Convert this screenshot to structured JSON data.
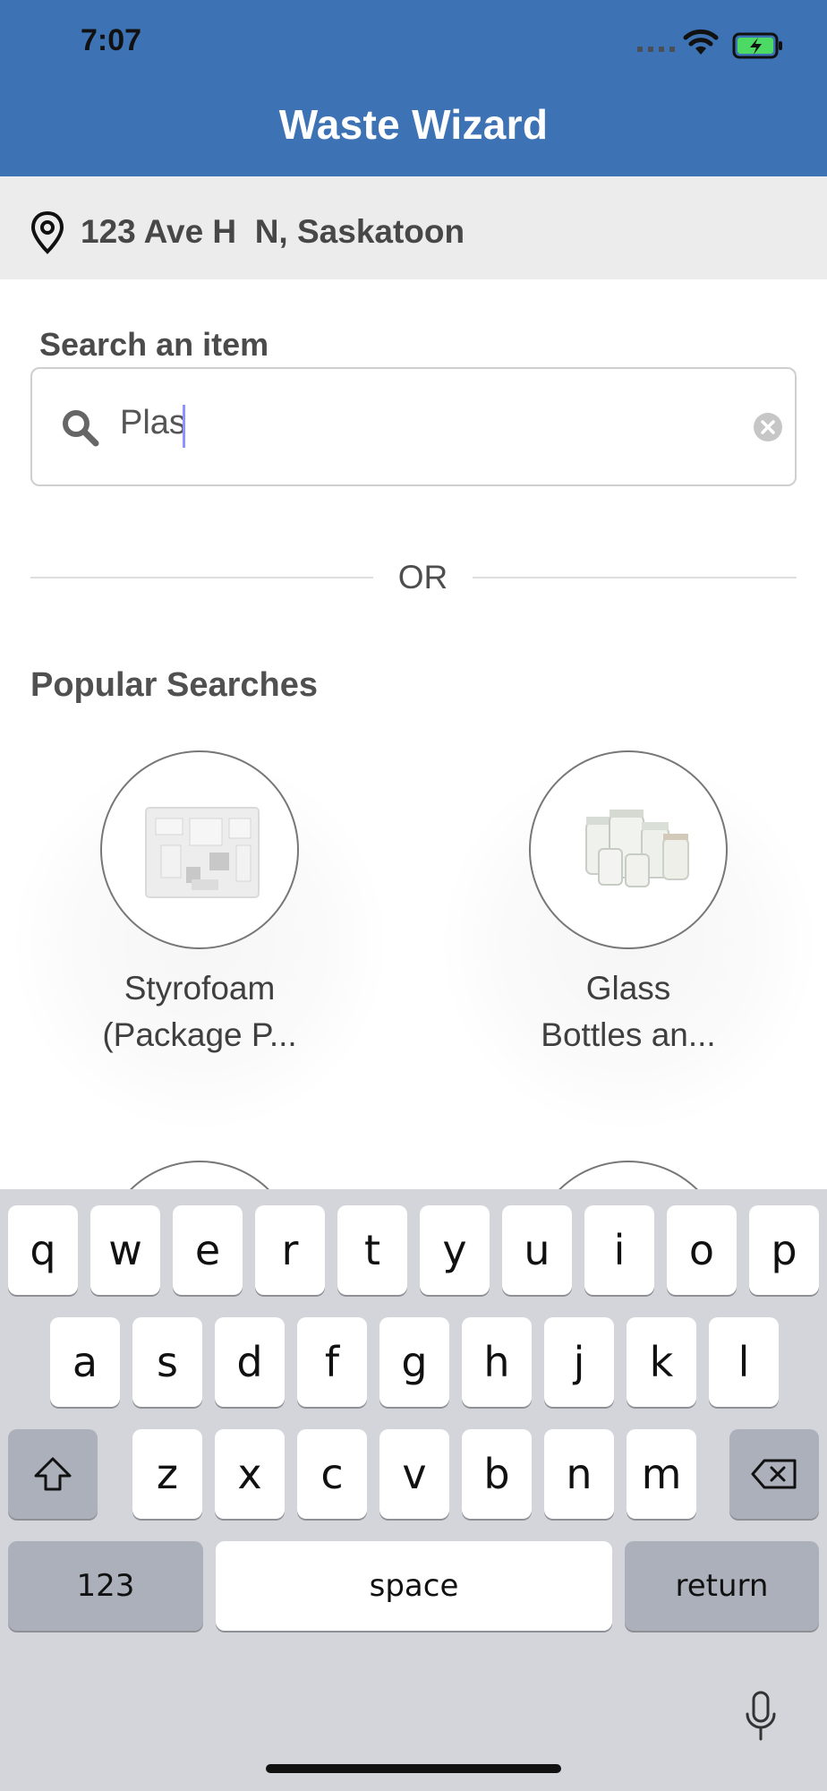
{
  "status_bar": {
    "time": "7:07"
  },
  "header": {
    "title": "Waste Wizard",
    "color": "#3d73b4"
  },
  "location": {
    "icon": "location-pin-icon",
    "address": "123 Ave H  N, Saskatoon"
  },
  "search": {
    "label": "Search an item",
    "value": "Plas",
    "icon": "search-icon",
    "clear_icon": "clear-icon"
  },
  "divider": {
    "text": "OR"
  },
  "popular": {
    "title": "Popular Searches",
    "items": [
      {
        "label_line1": "Styrofoam",
        "label_line2": "(Package P...",
        "image": "styrofoam-image"
      },
      {
        "label_line1": "Glass",
        "label_line2": "Bottles an...",
        "image": "glass-jars-image"
      }
    ]
  },
  "keyboard": {
    "row1": [
      "q",
      "w",
      "e",
      "r",
      "t",
      "y",
      "u",
      "i",
      "o",
      "p"
    ],
    "row2": [
      "a",
      "s",
      "d",
      "f",
      "g",
      "h",
      "j",
      "k",
      "l"
    ],
    "row3": [
      "z",
      "x",
      "c",
      "v",
      "b",
      "n",
      "m"
    ],
    "numbers_label": "123",
    "space_label": "space",
    "return_label": "return",
    "shift_icon": "shift-icon",
    "backspace_icon": "backspace-icon",
    "mic_icon": "microphone-icon"
  }
}
